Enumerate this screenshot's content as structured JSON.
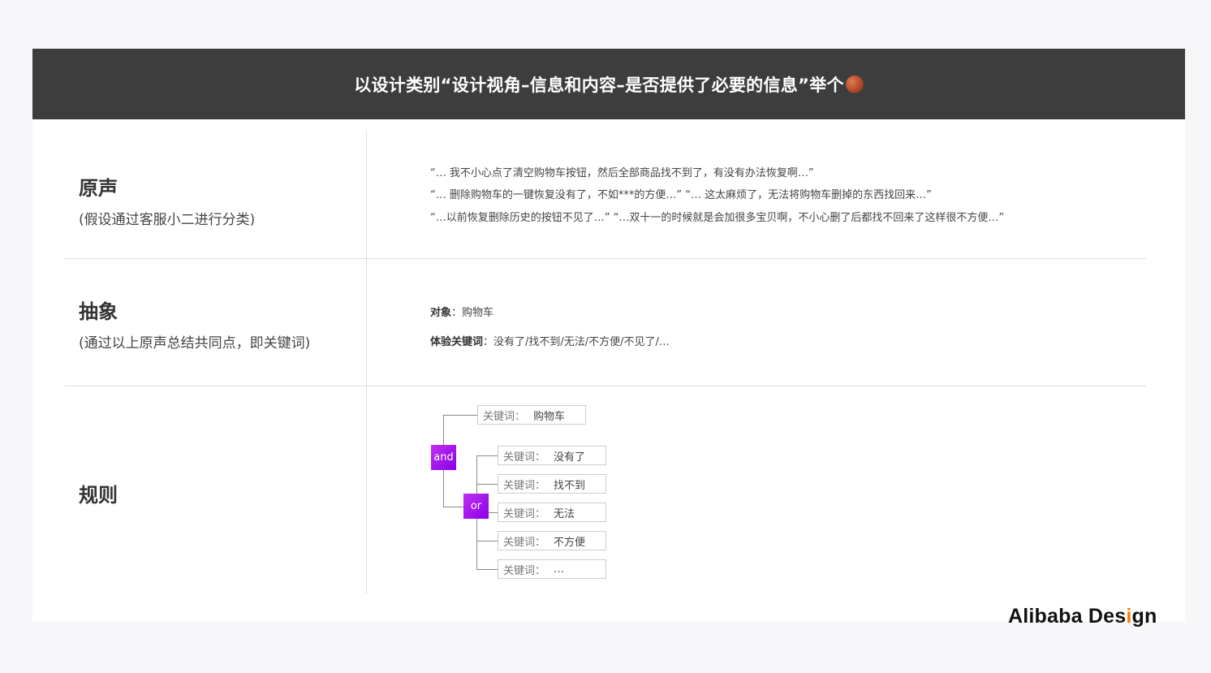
{
  "header": {
    "title": "以设计类别“设计视角–信息和内容–是否提供了必要的信息”举个"
  },
  "sections": {
    "voice": {
      "title": "原声",
      "subtitle": "(假设通过客服小二进行分类)",
      "quotes": [
        "“… 我不小心点了清空购物车按钮，然后全部商品找不到了，有没有办法恢复啊…”",
        "“… 删除购物车的一键恢复没有了，不如***的方便…” “… 这太麻烦了，无法将购物车删掉的东西找回来…”",
        "“…以前恢复删除历史的按钮不见了…” “…双十一的时候就是会加很多宝贝啊，不小心删了后都找不回来了这样很不方便…”"
      ]
    },
    "abstract": {
      "title": "抽象",
      "subtitle": "(通过以上原声总结共同点，即关键词)",
      "object_label": "对象",
      "object_value": "：购物车",
      "keywords_label": "体验关键词",
      "keywords_value": "：没有了/找不到/无法/不方便/不见了/…"
    },
    "rule": {
      "title": "规则",
      "and_label": "and",
      "or_label": "or",
      "keyword_label": "关键词：",
      "top_keyword": "购物车",
      "or_keywords": [
        "没有了",
        "找不到",
        "无法",
        "不方便",
        "…"
      ]
    }
  },
  "brand": {
    "name_before": "Alibaba Des",
    "name_accent": "i",
    "name_after": "gn"
  },
  "icons": {
    "title_emoji": "peach-icon"
  }
}
